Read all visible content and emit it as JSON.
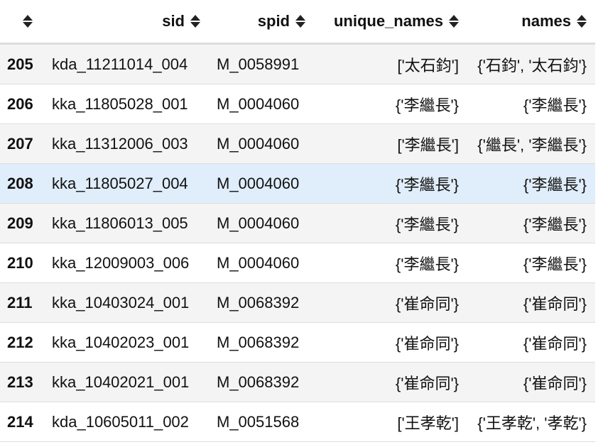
{
  "columns": {
    "index": "",
    "sid": "sid",
    "spid": "spid",
    "unique_names": "unique_names",
    "names": "names"
  },
  "rows": [
    {
      "index": "205",
      "sid": "kda_11211014_004",
      "spid": "M_0058991",
      "unique_names": "['太石鈞']",
      "names": "{'石鈞', '太石鈞'}"
    },
    {
      "index": "206",
      "sid": "kka_11805028_001",
      "spid": "M_0004060",
      "unique_names": "{'李繼長'}",
      "names": "{'李繼長'}"
    },
    {
      "index": "207",
      "sid": "kka_11312006_003",
      "spid": "M_0004060",
      "unique_names": "['李繼長']",
      "names": "{'繼長', '李繼長'}"
    },
    {
      "index": "208",
      "sid": "kka_11805027_004",
      "spid": "M_0004060",
      "unique_names": "{'李繼長'}",
      "names": "{'李繼長'}"
    },
    {
      "index": "209",
      "sid": "kka_11806013_005",
      "spid": "M_0004060",
      "unique_names": "{'李繼長'}",
      "names": "{'李繼長'}"
    },
    {
      "index": "210",
      "sid": "kka_12009003_006",
      "spid": "M_0004060",
      "unique_names": "{'李繼長'}",
      "names": "{'李繼長'}"
    },
    {
      "index": "211",
      "sid": "kka_10403024_001",
      "spid": "M_0068392",
      "unique_names": "{'崔命同'}",
      "names": "{'崔命同'}"
    },
    {
      "index": "212",
      "sid": "kka_10402023_001",
      "spid": "M_0068392",
      "unique_names": "{'崔命同'}",
      "names": "{'崔命同'}"
    },
    {
      "index": "213",
      "sid": "kka_10402021_001",
      "spid": "M_0068392",
      "unique_names": "{'崔命同'}",
      "names": "{'崔命同'}"
    },
    {
      "index": "214",
      "sid": "kda_10605011_002",
      "spid": "M_0051568",
      "unique_names": "['王孝乾']",
      "names": "{'王孝乾', '孝乾'}"
    }
  ],
  "highlighted_row": "208",
  "colors": {
    "stripe": "#f4f4f4",
    "highlight": "#e0edfa",
    "border": "#dddddd"
  },
  "icons": {
    "sort": "sort-both-icon"
  }
}
